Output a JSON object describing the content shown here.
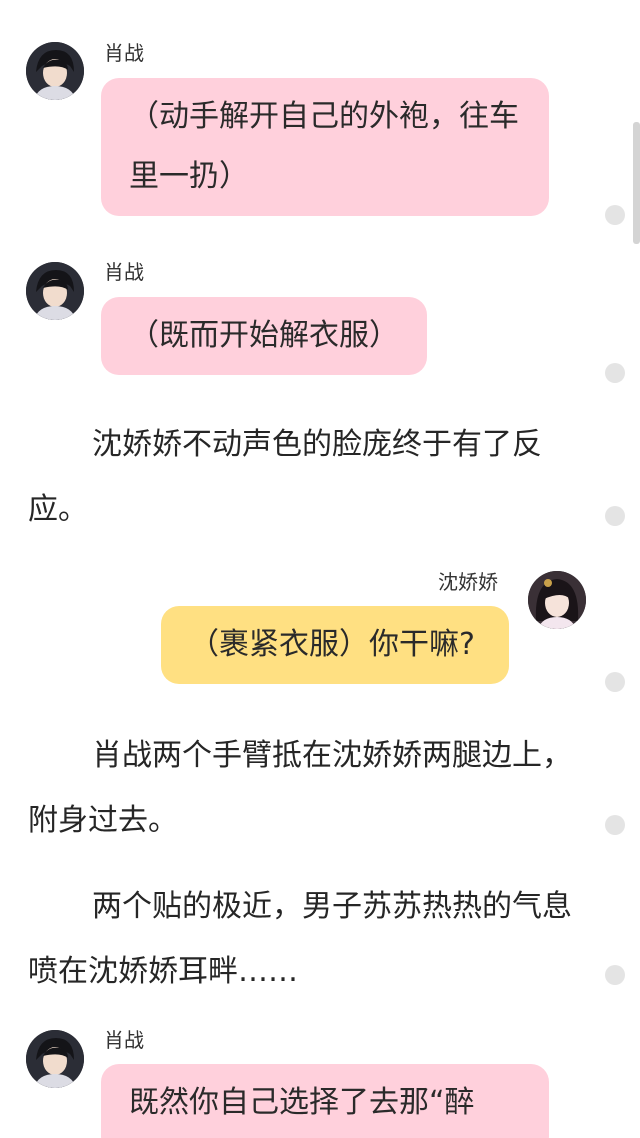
{
  "messages": [
    {
      "sender": "肖战",
      "avatar_icon": "man-avatar-icon",
      "text": "（动手解开自己的外袍，往车里一扔）"
    },
    {
      "sender": "肖战",
      "avatar_icon": "man-avatar-icon",
      "text": "（既而开始解衣服）"
    },
    {
      "sender": "沈娇娇",
      "avatar_icon": "woman-avatar-icon",
      "text": "（裹紧衣服）你干嘛?"
    },
    {
      "sender": "肖战",
      "avatar_icon": "man-avatar-icon",
      "text": "既然你自己选择了去那“醉"
    }
  ],
  "narration": [
    "沈娇娇不动声色的脸庞终于有了反应。",
    "肖战两个手臂抵在沈娇娇两腿边上，附身过去。",
    "两个贴的极近，男子苏苏热热的气息喷在沈娇娇耳畔……"
  ],
  "colors": {
    "left_bubble": "#ffd0dc",
    "right_bubble": "#ffe082",
    "side_dot": "#e4e4e4"
  }
}
